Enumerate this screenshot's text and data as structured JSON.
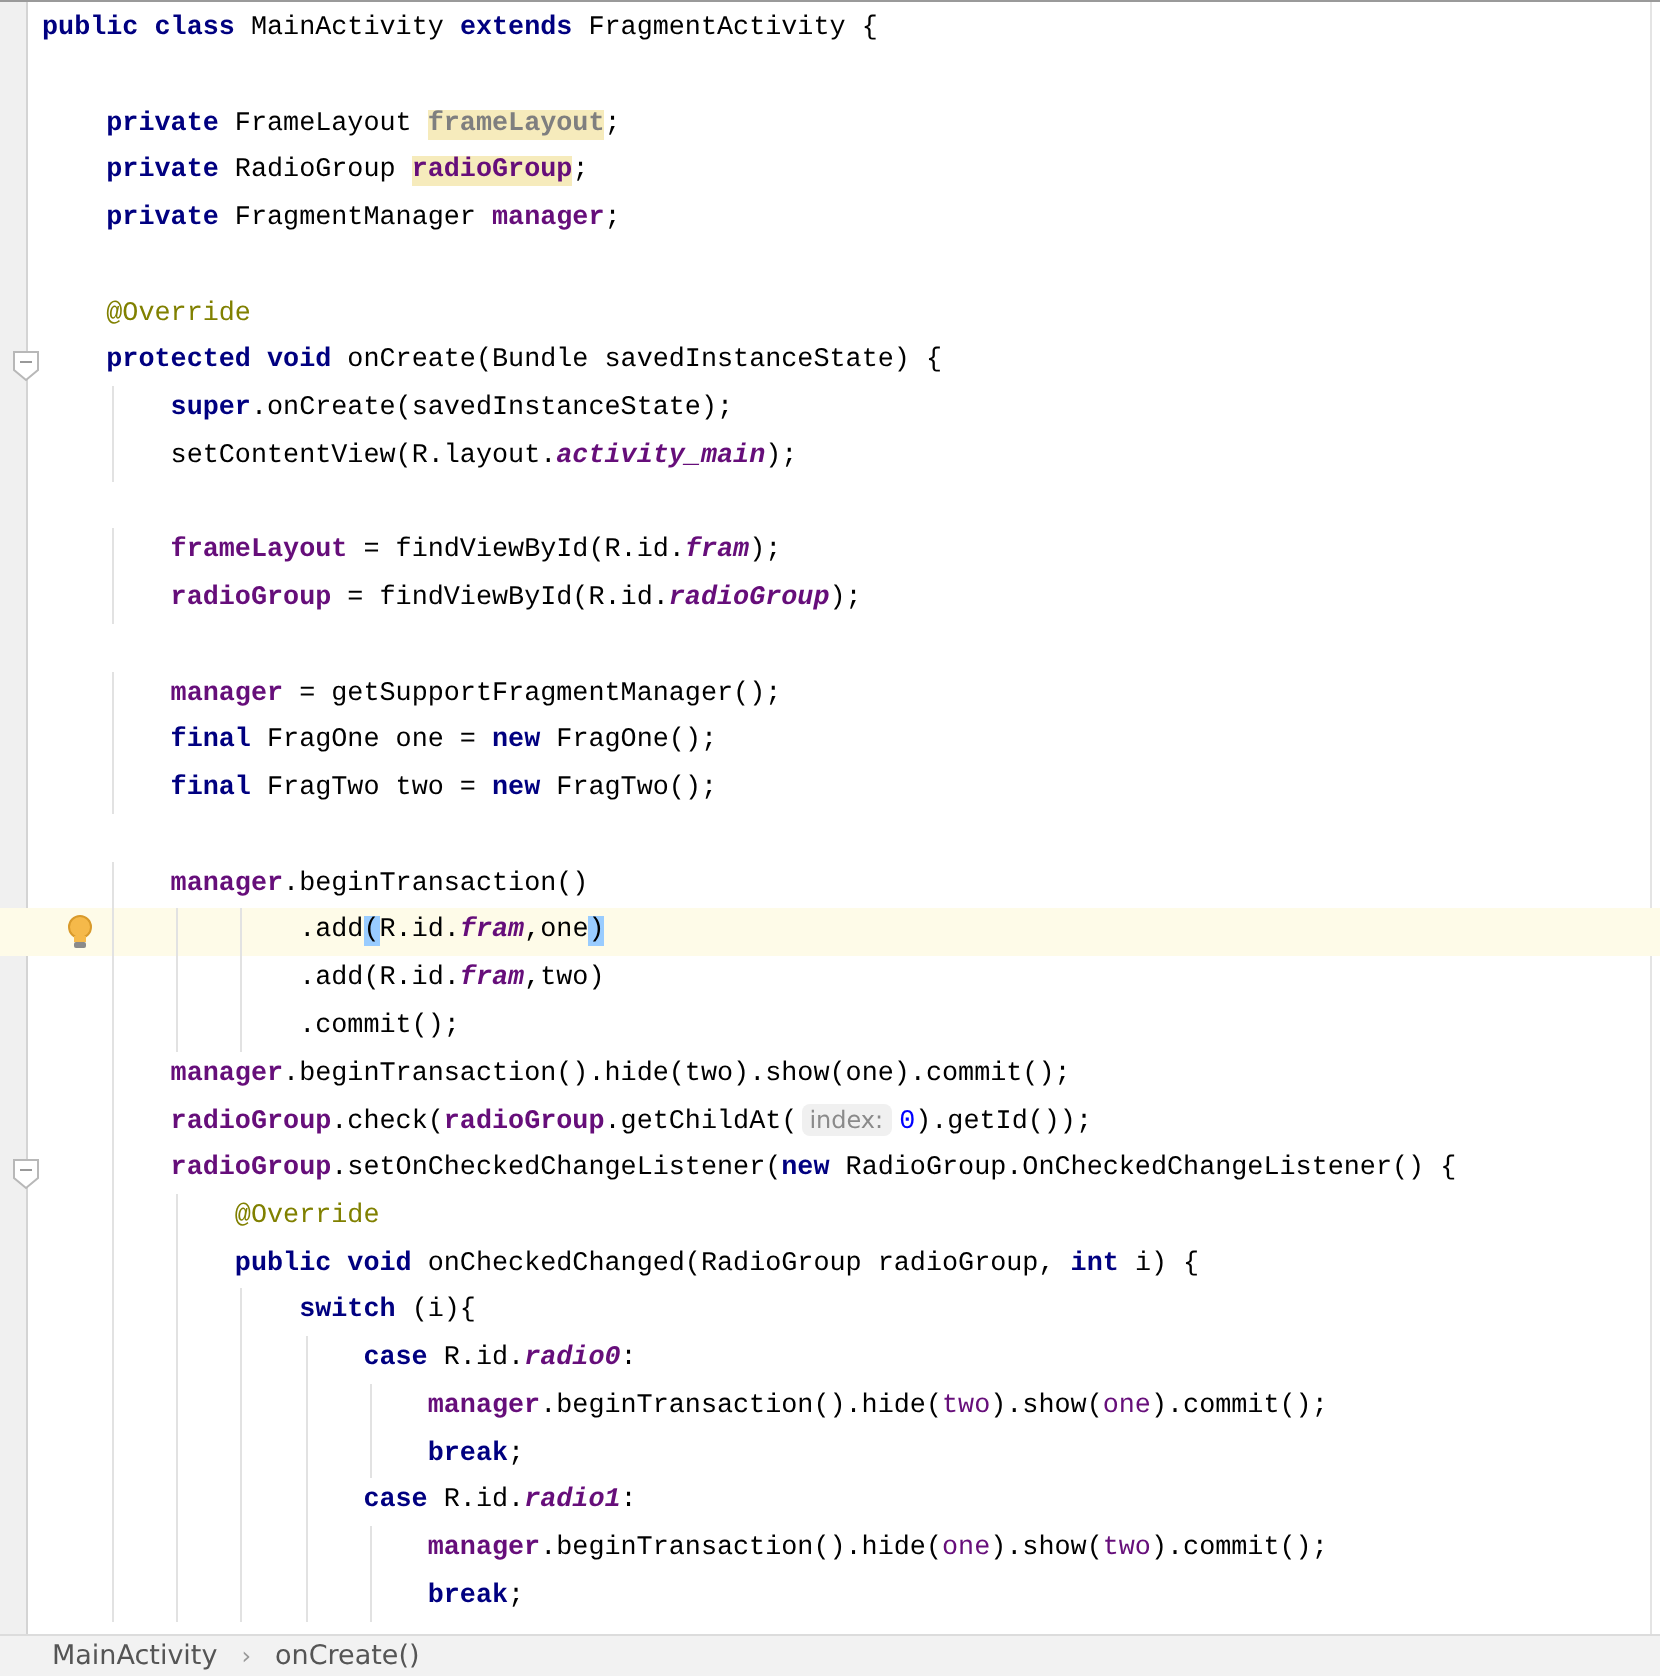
{
  "editor": {
    "lines": [
      {
        "current": false,
        "tokens": [
          {
            "text": "public class",
            "kind": "kw"
          },
          {
            "text": " MainActivity ",
            "kind": "plain"
          },
          {
            "text": "extends",
            "kind": "kw"
          },
          {
            "text": " FragmentActivity {",
            "kind": "plain"
          }
        ],
        "children": [
          {
            "current": false
          },
          {
            "current": false,
            "tokens": [
              {
                "text": "private",
                "kind": "kw"
              },
              {
                "text": " FrameLayout ",
                "kind": "plain"
              },
              {
                "text": "frameLayout",
                "kind": "unused",
                "usage": true
              },
              {
                "text": ";",
                "kind": "plain"
              }
            ]
          },
          {
            "current": false,
            "tokens": [
              {
                "text": "private",
                "kind": "kw"
              },
              {
                "text": " RadioGroup ",
                "kind": "plain"
              },
              {
                "text": "radioGroup",
                "kind": "field",
                "usage": true
              },
              {
                "text": ";",
                "kind": "plain"
              }
            ]
          },
          {
            "current": false,
            "tokens": [
              {
                "text": "private",
                "kind": "kw"
              },
              {
                "text": " FragmentManager ",
                "kind": "plain"
              },
              {
                "text": "manager",
                "kind": "field"
              },
              {
                "text": ";",
                "kind": "plain"
              }
            ]
          },
          {
            "current": false
          },
          {
            "current": false,
            "tokens": [
              {
                "text": "@Override",
                "kind": "annot"
              }
            ]
          },
          {
            "current": false,
            "fold": true,
            "tokens": [
              {
                "text": "protected void",
                "kind": "kw"
              },
              {
                "text": " onCreate(Bundle savedInstanceState) {",
                "kind": "plain"
              }
            ],
            "children": [
              {
                "current": false,
                "tokens": [
                  {
                    "text": "super",
                    "kind": "kw"
                  },
                  {
                    "text": ".onCreate(savedInstanceState);",
                    "kind": "plain"
                  }
                ]
              },
              {
                "current": false,
                "tokens": [
                  {
                    "text": "setContentView(R.layout.",
                    "kind": "plain"
                  },
                  {
                    "text": "activity_main",
                    "kind": "static"
                  },
                  {
                    "text": ");",
                    "kind": "plain"
                  }
                ]
              },
              {
                "current": false
              },
              {
                "current": false,
                "tokens": [
                  {
                    "text": "frameLayout",
                    "kind": "field"
                  },
                  {
                    "text": " = findViewById(R.id.",
                    "kind": "plain"
                  },
                  {
                    "text": "fram",
                    "kind": "static"
                  },
                  {
                    "text": ");",
                    "kind": "plain"
                  }
                ]
              },
              {
                "current": false,
                "tokens": [
                  {
                    "text": "radioGroup",
                    "kind": "field"
                  },
                  {
                    "text": " = findViewById(R.id.",
                    "kind": "plain"
                  },
                  {
                    "text": "radioGroup",
                    "kind": "static"
                  },
                  {
                    "text": ");",
                    "kind": "plain"
                  }
                ]
              },
              {
                "current": false
              },
              {
                "current": false,
                "tokens": [
                  {
                    "text": "manager",
                    "kind": "field"
                  },
                  {
                    "text": " = getSupportFragmentManager();",
                    "kind": "plain"
                  }
                ]
              },
              {
                "current": false,
                "tokens": [
                  {
                    "text": "final",
                    "kind": "kw"
                  },
                  {
                    "text": " FragOne one = ",
                    "kind": "plain"
                  },
                  {
                    "text": "new",
                    "kind": "kw"
                  },
                  {
                    "text": " FragOne();",
                    "kind": "plain"
                  }
                ]
              },
              {
                "current": false,
                "tokens": [
                  {
                    "text": "final",
                    "kind": "kw"
                  },
                  {
                    "text": " FragTwo two = ",
                    "kind": "plain"
                  },
                  {
                    "text": "new",
                    "kind": "kw"
                  },
                  {
                    "text": " FragTwo();",
                    "kind": "plain"
                  }
                ]
              },
              {
                "current": false
              },
              {
                "current": false,
                "chain": true,
                "tokens": [
                  {
                    "text": "manager",
                    "kind": "field"
                  },
                  {
                    "text": ".beginTransaction()",
                    "kind": "plain"
                  }
                ],
                "children": [
                  {
                    "current": true,
                    "bulb": true,
                    "tokens": [
                      {
                        "text": ".add",
                        "kind": "plain"
                      },
                      {
                        "text": "(",
                        "kind": "plain",
                        "matched": true
                      },
                      {
                        "text": "R.id.",
                        "kind": "plain"
                      },
                      {
                        "text": "fram",
                        "kind": "static"
                      },
                      {
                        "text": ",one",
                        "kind": "plain"
                      },
                      {
                        "text": ")",
                        "kind": "plain",
                        "matched": true
                      }
                    ]
                  },
                  {
                    "current": false,
                    "tokens": [
                      {
                        "text": ".add(R.id.",
                        "kind": "plain"
                      },
                      {
                        "text": "fram",
                        "kind": "static"
                      },
                      {
                        "text": ",two)",
                        "kind": "plain"
                      }
                    ]
                  },
                  {
                    "current": false,
                    "tokens": [
                      {
                        "text": ".commit();",
                        "kind": "plain"
                      }
                    ]
                  }
                ]
              },
              {
                "current": false,
                "tokens": [
                  {
                    "text": "manager",
                    "kind": "field"
                  },
                  {
                    "text": ".beginTransaction().hide(two).show(one).commit();",
                    "kind": "plain"
                  }
                ]
              },
              {
                "current": false,
                "tokens": [
                  {
                    "text": "radioGroup",
                    "kind": "field"
                  },
                  {
                    "text": ".check(",
                    "kind": "plain"
                  },
                  {
                    "text": "radioGroup",
                    "kind": "field"
                  },
                  {
                    "text": ".getChildAt(",
                    "kind": "plain"
                  },
                  {
                    "text": "index:",
                    "kind": "hint"
                  },
                  {
                    "text": "0",
                    "kind": "num"
                  },
                  {
                    "text": ").getId());",
                    "kind": "plain"
                  }
                ]
              },
              {
                "current": false,
                "fold": true,
                "tokens": [
                  {
                    "text": "radioGroup",
                    "kind": "field"
                  },
                  {
                    "text": ".setOnCheckedChangeListener(",
                    "kind": "plain"
                  },
                  {
                    "text": "new",
                    "kind": "kw"
                  },
                  {
                    "text": " RadioGroup.OnCheckedChangeListener() {",
                    "kind": "plain"
                  }
                ],
                "children": [
                  {
                    "current": false,
                    "tokens": [
                      {
                        "text": "@Override",
                        "kind": "annot"
                      }
                    ]
                  },
                  {
                    "current": false,
                    "tokens": [
                      {
                        "text": "public void",
                        "kind": "kw"
                      },
                      {
                        "text": " onCheckedChanged(RadioGroup radioGroup, ",
                        "kind": "plain"
                      },
                      {
                        "text": "int",
                        "kind": "kw"
                      },
                      {
                        "text": " i) {",
                        "kind": "plain"
                      }
                    ],
                    "children": [
                      {
                        "current": false,
                        "tokens": [
                          {
                            "text": "switch",
                            "kind": "kw"
                          },
                          {
                            "text": " (i){",
                            "kind": "plain"
                          }
                        ],
                        "children": [
                          {
                            "current": false,
                            "tokens": [
                              {
                                "text": "case",
                                "kind": "kw"
                              },
                              {
                                "text": " R.id.",
                                "kind": "plain"
                              },
                              {
                                "text": "radio0",
                                "kind": "static"
                              },
                              {
                                "text": ":",
                                "kind": "plain"
                              }
                            ],
                            "children": [
                              {
                                "current": false,
                                "tokens": [
                                  {
                                    "text": "manager",
                                    "kind": "field"
                                  },
                                  {
                                    "text": ".beginTransaction().hide(",
                                    "kind": "plain"
                                  },
                                  {
                                    "text": "two",
                                    "kind": "captured"
                                  },
                                  {
                                    "text": ").show(",
                                    "kind": "plain"
                                  },
                                  {
                                    "text": "one",
                                    "kind": "captured"
                                  },
                                  {
                                    "text": ").commit();",
                                    "kind": "plain"
                                  }
                                ]
                              },
                              {
                                "current": false,
                                "tokens": [
                                  {
                                    "text": "break",
                                    "kind": "kw"
                                  },
                                  {
                                    "text": ";",
                                    "kind": "plain"
                                  }
                                ]
                              }
                            ]
                          },
                          {
                            "current": false,
                            "tokens": [
                              {
                                "text": "case",
                                "kind": "kw"
                              },
                              {
                                "text": " R.id.",
                                "kind": "plain"
                              },
                              {
                                "text": "radio1",
                                "kind": "static"
                              },
                              {
                                "text": ":",
                                "kind": "plain"
                              }
                            ],
                            "children": [
                              {
                                "current": false,
                                "tokens": [
                                  {
                                    "text": "manager",
                                    "kind": "field"
                                  },
                                  {
                                    "text": ".beginTransaction().hide(",
                                    "kind": "plain"
                                  },
                                  {
                                    "text": "one",
                                    "kind": "captured"
                                  },
                                  {
                                    "text": ").show(",
                                    "kind": "plain"
                                  },
                                  {
                                    "text": "two",
                                    "kind": "captured"
                                  },
                                  {
                                    "text": ").commit();",
                                    "kind": "plain"
                                  }
                                ]
                              },
                              {
                                "current": false,
                                "tokens": [
                                  {
                                    "text": "break",
                                    "kind": "kw"
                                  },
                                  {
                                    "text": ";",
                                    "kind": "plain"
                                  }
                                ]
                              }
                            ]
                          }
                        ]
                      }
                    ]
                  }
                ]
              }
            ]
          }
        ]
      }
    ]
  },
  "breadcrumb": {
    "items": [
      "MainActivity",
      "onCreate()"
    ],
    "separator": "›"
  }
}
